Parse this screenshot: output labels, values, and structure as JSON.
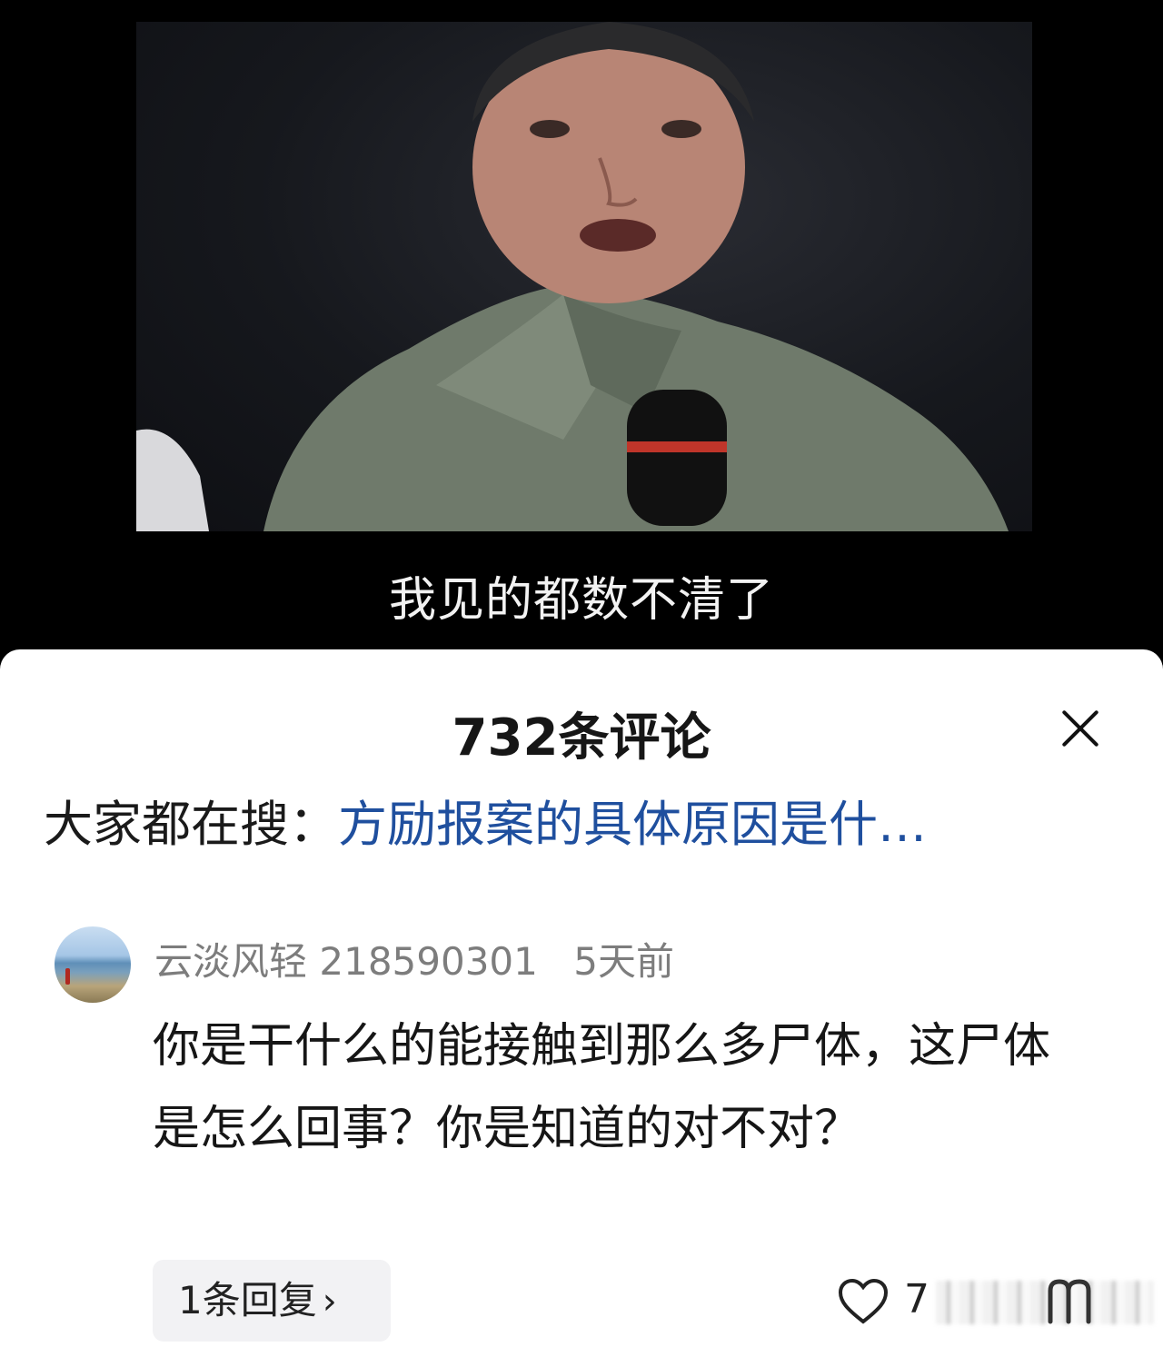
{
  "video": {
    "subtitle": "我见的都数不清了"
  },
  "comments_panel": {
    "title": "732条评论",
    "close_icon": "close-icon",
    "hot_search": {
      "label": "大家都在搜：",
      "link": "方励报案的具体原因是什…"
    },
    "comment": {
      "username": "云淡风轻",
      "user_id": "218590301",
      "time": "5天前",
      "text": "你是干什么的能接触到那么多尸体，这尸体是怎么回事？你是知道的对不对？",
      "reply_label": "1条回复",
      "like_icon": "heart-icon",
      "like_count": "7"
    }
  }
}
